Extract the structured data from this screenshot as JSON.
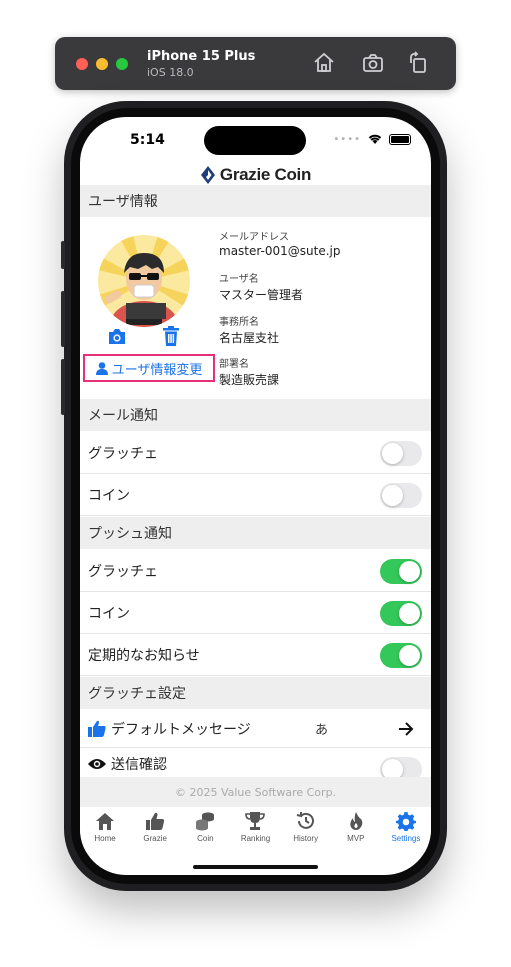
{
  "simulator": {
    "device": "iPhone 15 Plus",
    "os": "iOS 18.0",
    "icons": [
      "home-icon",
      "screenshot-icon",
      "rotate-icon"
    ]
  },
  "status_bar": {
    "time": "5:14",
    "dots": "••••"
  },
  "app": {
    "logo_text": "Grazie Coin"
  },
  "user_section": {
    "title": "ユーザ情報",
    "email_label": "メールアドレス",
    "email": "master-001@sute.jp",
    "username_label": "ユーザ名",
    "username": "マスター管理者",
    "office_label": "事務所名",
    "office": "名古屋支社",
    "dept_label": "部署名",
    "dept": "製造販売課",
    "edit_button": "ユーザ情報変更"
  },
  "mail_notify": {
    "title": "メール通知",
    "items": [
      {
        "label": "グラッチェ",
        "on": false
      },
      {
        "label": "コイン",
        "on": false
      }
    ]
  },
  "push_notify": {
    "title": "プッシュ通知",
    "items": [
      {
        "label": "グラッチェ",
        "on": true
      },
      {
        "label": "コイン",
        "on": true
      },
      {
        "label": "定期的なお知らせ",
        "on": true
      }
    ]
  },
  "grazie_settings": {
    "title": "グラッチェ設定",
    "default_message_label": "デフォルトメッセージ",
    "default_message_value": "あ",
    "send_confirm_label": "送信確認",
    "send_confirm_on": false
  },
  "footer": {
    "copyright": "© 2025 Value Software Corp."
  },
  "tabs": [
    {
      "label": "Home",
      "icon": "home-icon"
    },
    {
      "label": "Grazie",
      "icon": "thumbs-up-icon"
    },
    {
      "label": "Coin",
      "icon": "coins-icon"
    },
    {
      "label": "Ranking",
      "icon": "trophy-icon"
    },
    {
      "label": "History",
      "icon": "history-icon"
    },
    {
      "label": "MVP",
      "icon": "flame-icon"
    },
    {
      "label": "Settings",
      "icon": "gear-icon",
      "active": true
    }
  ],
  "colors": {
    "accent": "#1a73e8",
    "toggle_on": "#34c759",
    "highlight_border": "#e6317a"
  }
}
